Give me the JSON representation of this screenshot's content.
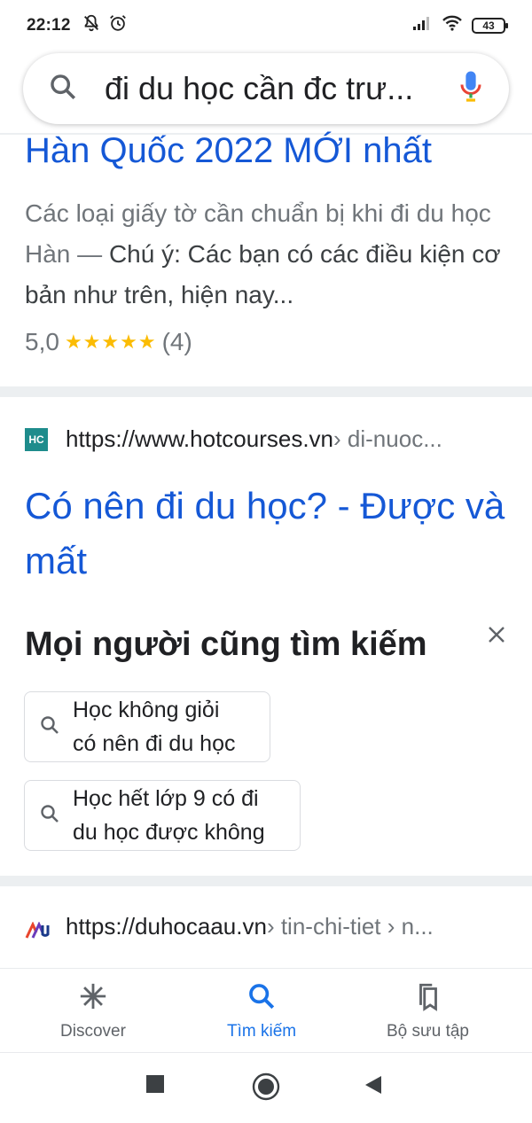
{
  "status_bar": {
    "time": "22:12",
    "battery": "43",
    "icons": [
      "notifications-off-icon",
      "alarm-icon",
      "signal-icon",
      "wifi-icon",
      "battery-icon"
    ]
  },
  "search": {
    "query": "đi du học cần đc trư...",
    "icons": [
      "search-icon",
      "mic-icon"
    ]
  },
  "result1": {
    "title_tail": "Hàn Quốc 2022 MỚI nhất",
    "snippet_gray": "Các loại giấy tờ cần chuẩn bị khi đi du học Hàn — ",
    "snippet_dark": "Chú ý: Các bạn có các điều kiện cơ bản như trên, hiện nay...",
    "rating_value": "5,0",
    "rating_stars": "★★★★★",
    "rating_count": "(4)"
  },
  "result2": {
    "favicon_text": "HC",
    "url": "https://www.hotcourses.vn",
    "path": " › di-nuoc...",
    "title": "Có nên đi du học? - Được và mất"
  },
  "people_also_search": {
    "title": "Mọi người cũng tìm kiếm",
    "chips": [
      {
        "line1": "Học không giỏi",
        "line2": "có nên đi du học"
      },
      {
        "line1": "Học hết lớp 9 có đi",
        "line2": "du học được không"
      }
    ]
  },
  "result3": {
    "url": "https://duhocaau.vn",
    "path": " › tin-chi-tiet › n..."
  },
  "bottom_nav": {
    "items": [
      {
        "label": "Discover",
        "icon": "asterisk-icon"
      },
      {
        "label": "Tìm kiếm",
        "icon": "search-icon",
        "active": true
      },
      {
        "label": "Bộ sưu tập",
        "icon": "collections-icon"
      }
    ]
  },
  "colors": {
    "link": "#1558d6",
    "accent": "#1a73e8",
    "stars": "#fbbc04",
    "favicon_hc": "#1e8c8c"
  }
}
